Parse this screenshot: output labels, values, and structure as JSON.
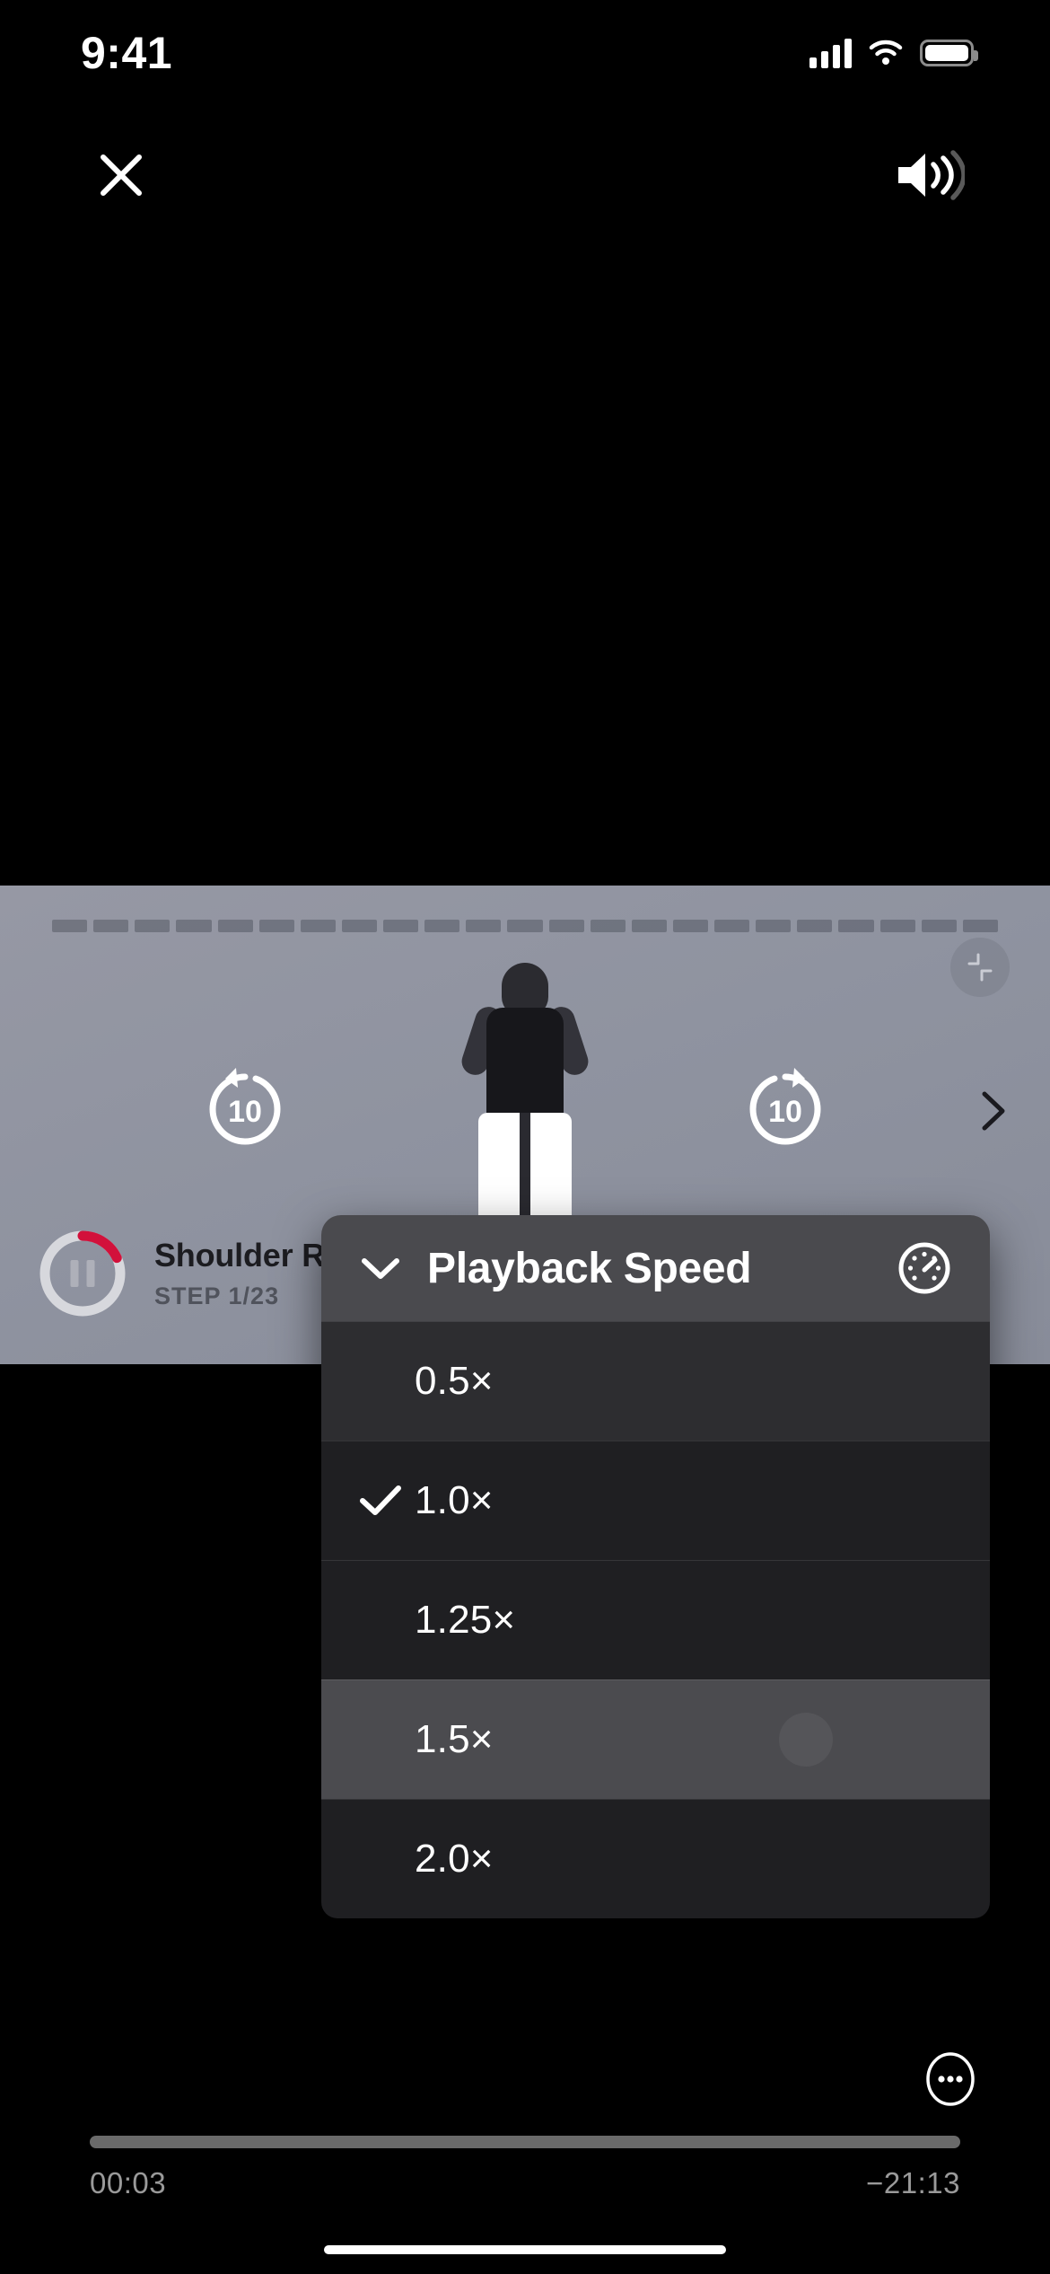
{
  "status_bar": {
    "time": "9:41",
    "icons": [
      "cellular-signal-icon",
      "wifi-icon",
      "battery-icon"
    ]
  },
  "top_nav": {
    "close_icon": "close-icon",
    "volume_icon": "volume-on-icon"
  },
  "video": {
    "fullscreen_icon": "fullscreen-expand-icon",
    "rewind_label": "10",
    "forward_label": "10",
    "next_icon": "chevron-right-icon",
    "segments_total": 23,
    "segments_completed": 0,
    "exercise": {
      "title": "Shoulder Rolls",
      "step_label": "STEP 1/23",
      "pause_icon": "pause-icon",
      "ring_progress_percent": 18,
      "ring_color": "#D2113B",
      "ring_track_color": "#d7d8dd"
    }
  },
  "speed_menu": {
    "title": "Playback Speed",
    "collapse_icon": "chevron-down-icon",
    "gauge_icon": "speedometer-icon",
    "selected": "1.0×",
    "pressed": "1.5×",
    "options": [
      {
        "label": "0.5×",
        "checked": false
      },
      {
        "label": "1.0×",
        "checked": true
      },
      {
        "label": "1.25×",
        "checked": false
      },
      {
        "label": "1.5×",
        "checked": false
      },
      {
        "label": "2.0×",
        "checked": false
      }
    ],
    "check_icon": "checkmark-icon"
  },
  "player_bar": {
    "more_icon": "more-options-icon",
    "elapsed": "00:03",
    "remaining": "−21:13",
    "progress_percent": 0
  }
}
